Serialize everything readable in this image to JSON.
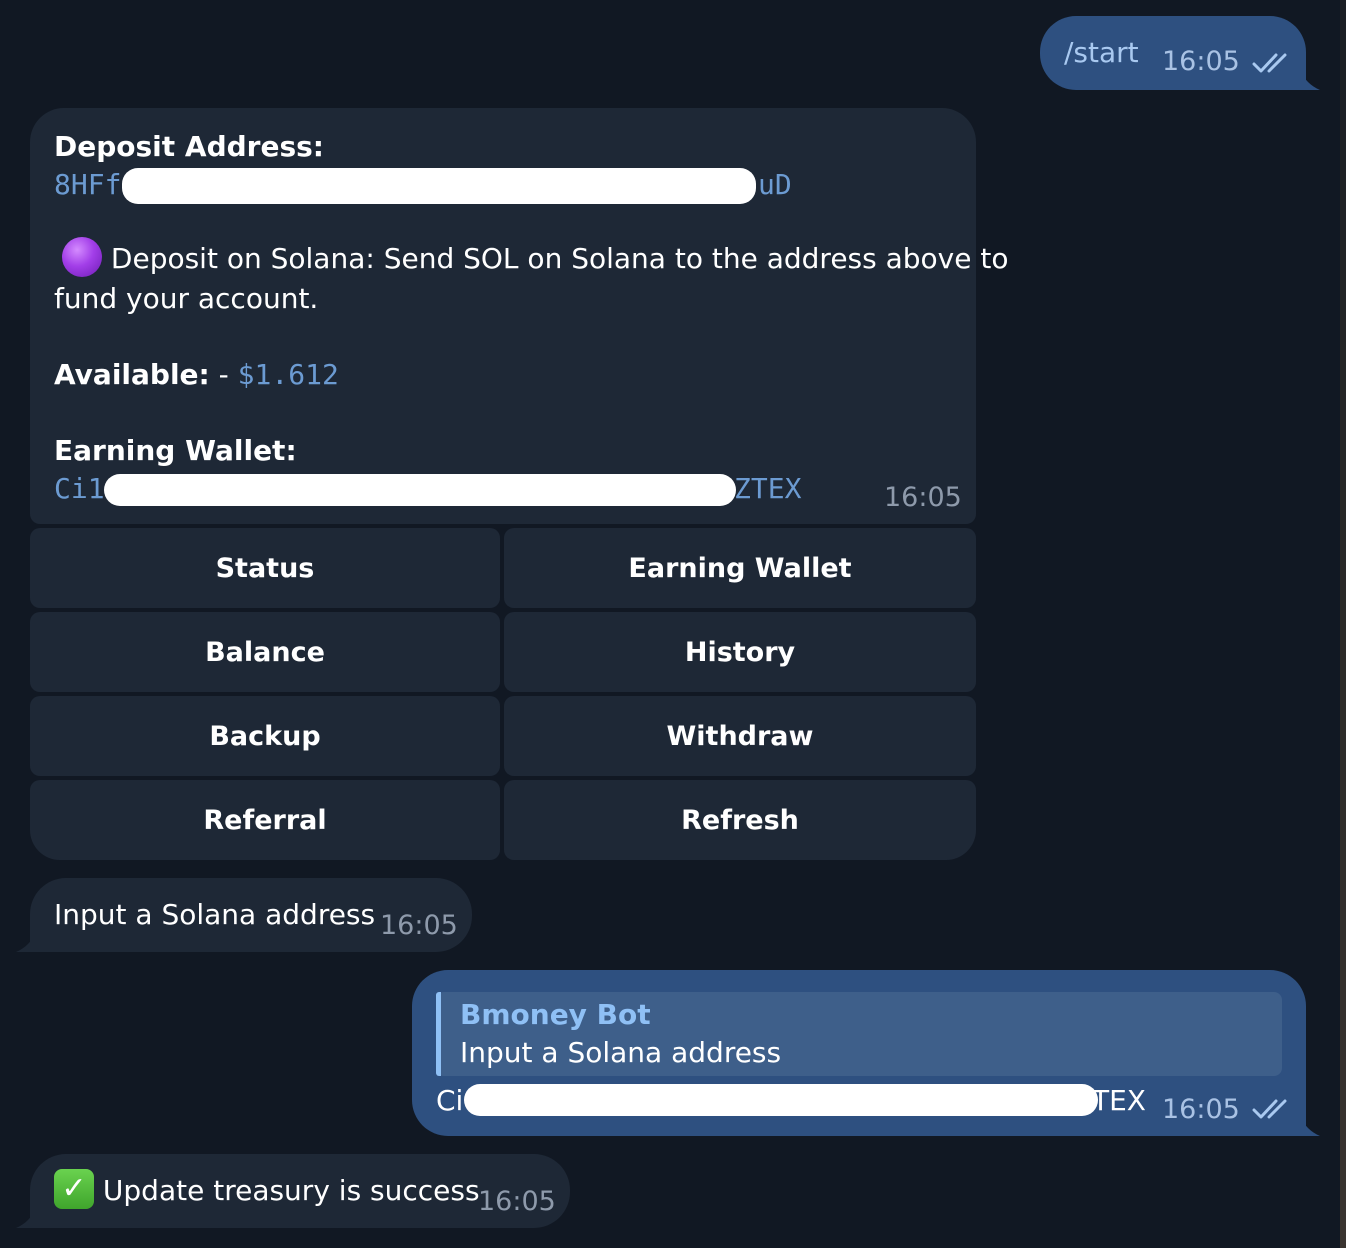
{
  "messages": {
    "start": {
      "text": "/start",
      "time": "16:05"
    },
    "deposit": {
      "deposit_label": "Deposit Address:",
      "deposit_address_start": "8HFf",
      "deposit_address_end": "uD",
      "deposit_info": "Deposit on Solana: Send SOL on Solana to the address above to",
      "deposit_info_cont": "fund your account.",
      "available_label": "Available:",
      "available_sep": " - ",
      "available_value": "$1.612",
      "earning_label": "Earning Wallet:",
      "earning_address_start": "Ci1",
      "earning_address_end": "ZTEX",
      "time": "16:05"
    },
    "input_prompt": {
      "text": "Input a Solana address",
      "time": "16:05"
    },
    "reply_msg": {
      "quote_author": "Bmoney Bot",
      "quote_text": "Input a Solana address",
      "text_start": "Ci",
      "text_end": "TEX",
      "time": "16:05"
    },
    "success": {
      "text": "Update treasury is success",
      "time": "16:05"
    }
  },
  "keyboard": {
    "status": "Status",
    "earning_wallet": "Earning Wallet",
    "balance": "Balance",
    "history": "History",
    "backup": "Backup",
    "withdraw": "Withdraw",
    "referral": "Referral",
    "refresh": "Refresh"
  },
  "icons": {
    "read_receipt": "double-check-icon",
    "purple_circle": "purple-circle-emoji",
    "check_mark": "check-mark-emoji"
  },
  "colors": {
    "background": "#111823",
    "incoming_bubble": "#1e2836",
    "outgoing_bubble": "#2e5080",
    "link_mono": "#6c9bd2",
    "quote_author": "#8fc0f5"
  }
}
